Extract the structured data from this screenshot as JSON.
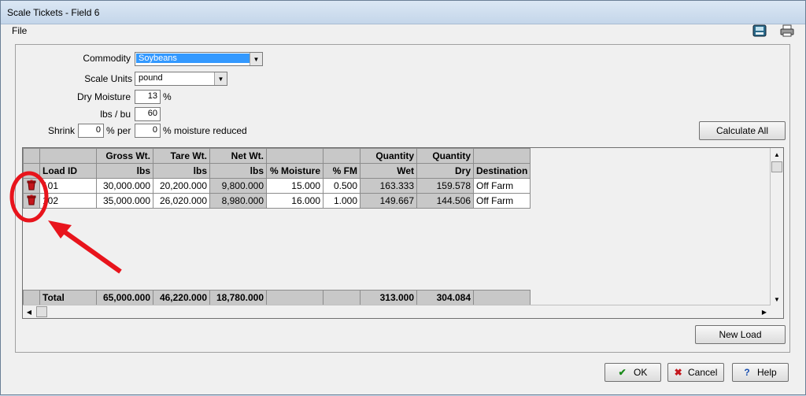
{
  "window": {
    "title": "Scale Tickets - Field 6"
  },
  "menu": {
    "file": "File"
  },
  "toolbar": {
    "calculator_icon": "calculator-icon",
    "print_icon": "printer-icon"
  },
  "form": {
    "commodity_label": "Commodity",
    "commodity_value": "Soybeans",
    "scale_units_label": "Scale Units",
    "scale_units_value": "pound",
    "dry_moisture_label": "Dry Moisture",
    "dry_moisture_value": "13",
    "dry_moisture_unit": "%",
    "lbs_bu_label": "lbs / bu",
    "lbs_bu_value": "60",
    "shrink_label": "Shrink",
    "shrink_value": "0",
    "shrink_per_label": "% per",
    "moisture_reduced_value": "0",
    "moisture_reduced_label": "% moisture reduced"
  },
  "buttons": {
    "calculate_all": "Calculate All",
    "new_load": "New Load",
    "ok": "OK",
    "cancel": "Cancel",
    "help": "Help"
  },
  "grid": {
    "header_top": [
      "",
      "Gross Wt.",
      "Tare Wt.",
      "Net Wt.",
      "",
      "",
      "Quantity",
      "Quantity",
      ""
    ],
    "header_bottom": [
      "Load ID",
      "lbs",
      "lbs",
      "lbs",
      "% Moisture",
      "% FM",
      "Wet",
      "Dry",
      "Destination"
    ],
    "rows": [
      [
        "101",
        "30,000.000",
        "20,200.000",
        "9,800.000",
        "15.000",
        "0.500",
        "163.333",
        "159.578",
        "Off Farm"
      ],
      [
        "102",
        "35,000.000",
        "26,020.000",
        "8,980.000",
        "16.000",
        "1.000",
        "149.667",
        "144.506",
        "Off Farm"
      ]
    ],
    "total": [
      "Total",
      "65,000.000",
      "46,220.000",
      "18,780.000",
      "",
      "",
      "313.000",
      "304.084",
      ""
    ]
  },
  "colors": {
    "annotation": "#e8141c",
    "grid_gray": "#c8c8c8"
  }
}
